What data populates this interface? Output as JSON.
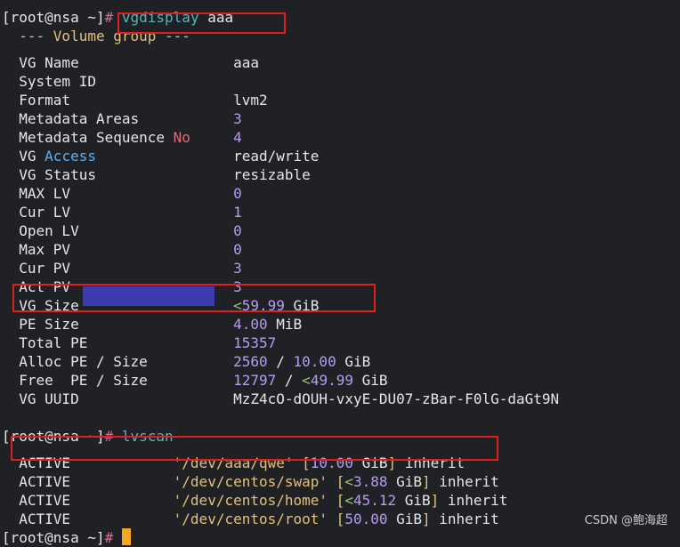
{
  "prompt": {
    "user_host": "[root@nsa ~]",
    "symbol": "#"
  },
  "commands": {
    "vgdisplay": "vgdisplay",
    "vg_arg": "aaa",
    "lvscan": "lvscan"
  },
  "vgdisplay": {
    "header": "  --- Volume group ---",
    "rows": [
      {
        "key": "VG Name",
        "value": "aaa"
      },
      {
        "key": "System ID",
        "value": ""
      },
      {
        "key": "Format",
        "value": "lvm2"
      },
      {
        "key": "Metadata Areas",
        "value": "3"
      },
      {
        "key_a": "Metadata Sequence ",
        "key_b": "No",
        "value": "4"
      },
      {
        "key_a": "VG ",
        "key_b": "Access",
        "value": "read/write"
      },
      {
        "key": "VG Status",
        "value": "resizable"
      },
      {
        "key": "MAX LV",
        "value": "0"
      },
      {
        "key": "Cur LV",
        "value": "1"
      },
      {
        "key": "Open LV",
        "value": "0"
      },
      {
        "key": "Max PV",
        "value": "0"
      },
      {
        "key": "Cur PV",
        "value": "3"
      },
      {
        "key": "Act PV",
        "value": "3"
      },
      {
        "key": "VG Size",
        "value_prefix": "<",
        "value": "59.99",
        "unit": " GiB"
      },
      {
        "key": "PE Size",
        "value": "4.00",
        "unit": " MiB"
      },
      {
        "key": "Total PE",
        "value": "15357"
      },
      {
        "key": "Alloc PE / Size",
        "value": "2560",
        "sep": " / ",
        "value2": "10.00",
        "unit": " GiB"
      },
      {
        "key": "Free  PE / Size",
        "value": "12797",
        "sep": " / ",
        "value2_prefix": "<",
        "value2": "49.99",
        "unit": " GiB"
      },
      {
        "key": "VG UUID",
        "value": "MzZ4cO-dOUH-vxyE-DU07-zBar-F0lG-daGt9N"
      }
    ]
  },
  "lvscan": {
    "rows": [
      {
        "state": "ACTIVE",
        "path": "'/dev/aaa/qwe'",
        "size_prefix": "",
        "size": "10.00",
        "unit": " GiB",
        "policy": "inherit"
      },
      {
        "state": "ACTIVE",
        "path": "'/dev/centos/swap'",
        "size_prefix": "<",
        "size": "3.88",
        "unit": " GiB",
        "policy": "inherit"
      },
      {
        "state": "ACTIVE",
        "path": "'/dev/centos/home'",
        "size_prefix": "<",
        "size": "45.12",
        "unit": " GiB",
        "policy": "inherit"
      },
      {
        "state": "ACTIVE",
        "path": "'/dev/centos/root'",
        "size_prefix": "",
        "size": "50.00",
        "unit": " GiB",
        "policy": "inherit"
      }
    ]
  },
  "watermark": "CSDN @鲍海超",
  "colors": {
    "background": "#1f2124",
    "highlight_box": "#e02020",
    "redaction": "#3a3cb0",
    "cursor": "#f5a623"
  }
}
